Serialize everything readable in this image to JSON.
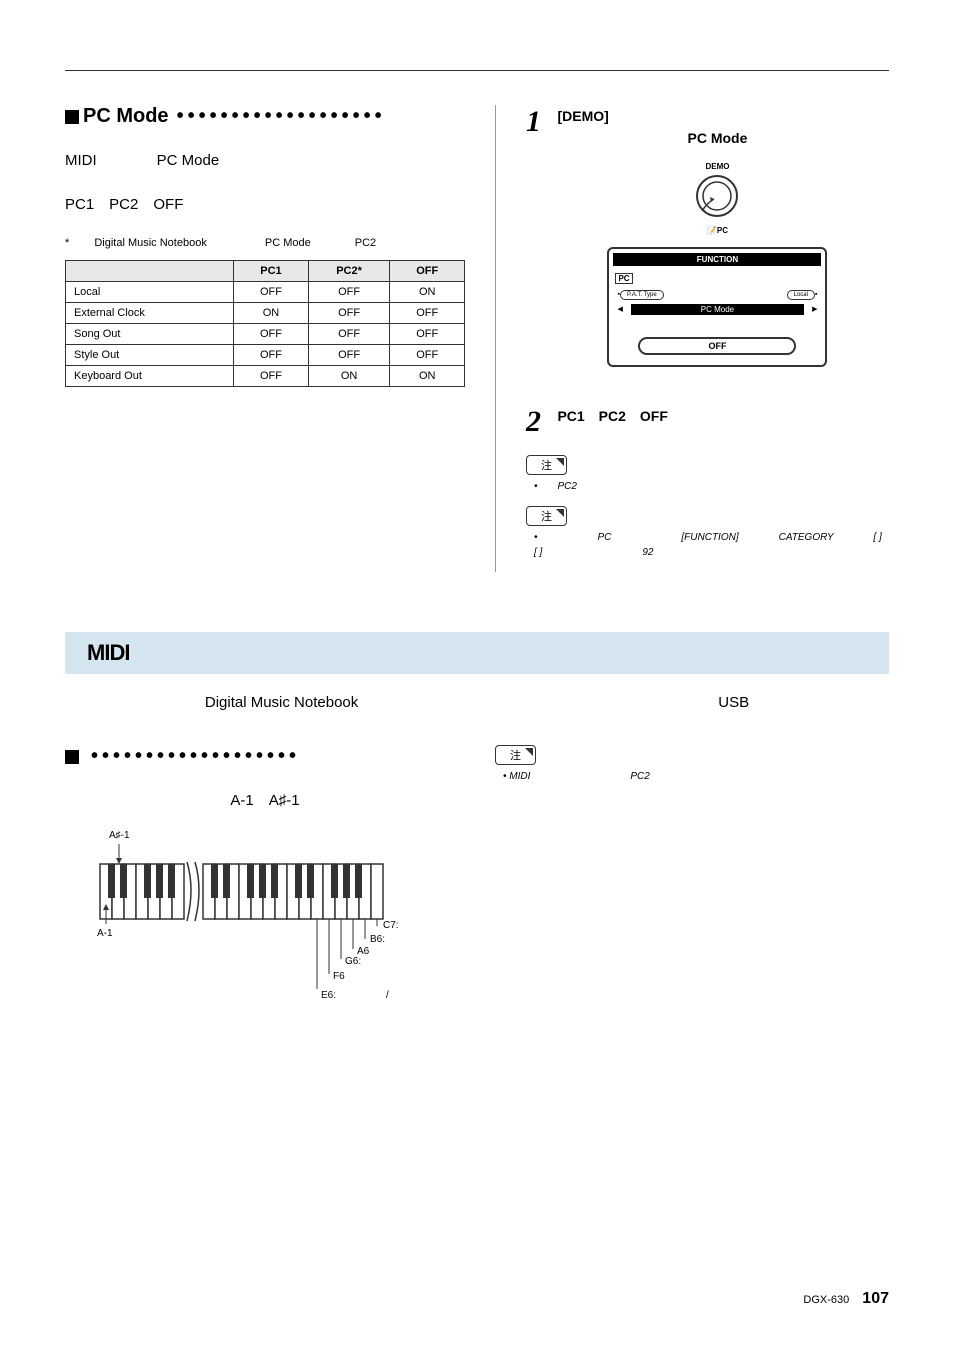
{
  "sections": {
    "pcmode": {
      "heading": "PC Mode",
      "body1": "MIDI　　　　PC Mode",
      "body2": "PC1　PC2　OFF",
      "note": "* 　　Digital Music Notebook 　　　　　PC Mode　　　　PC2"
    },
    "table": {
      "headers": [
        "",
        "PC1",
        "PC2*",
        "OFF"
      ],
      "rows": [
        [
          "Local",
          "OFF",
          "OFF",
          "ON"
        ],
        [
          "External Clock",
          "ON",
          "OFF",
          "OFF"
        ],
        [
          "Song Out",
          "OFF",
          "OFF",
          "OFF"
        ],
        [
          "Style Out",
          "OFF",
          "OFF",
          "OFF"
        ],
        [
          "Keyboard Out",
          "OFF",
          "ON",
          "ON"
        ]
      ]
    },
    "step1": {
      "num": "1",
      "demo": "[DEMO]",
      "title": "PC Mode",
      "demo_label": "DEMO",
      "pc_label": "PC",
      "lcd": {
        "function": "FUNCTION",
        "pc": "PC",
        "pat": "P.A.T. Type",
        "local": "Local",
        "mode": "PC Mode",
        "off": "OFF"
      }
    },
    "step2": {
      "num": "2",
      "title": "PC1　PC2　OFF",
      "note1_label": "注",
      "note1": "•　　PC2",
      "note2_label": "注",
      "note2": "•　　　　　　PC　　　　　　　[FUNCTION]　　　　CATEGORY　　　　[ ]　[ ]　　　　　　　　　　92"
    },
    "midi": {
      "heading": "MIDI",
      "body": "Digital Music Notebook　　　　　　　　　　　　　　　　　　　　　　　　USB",
      "subheading": "",
      "subtext": "A-1　A♯-1",
      "note_label": "注",
      "note": "• MIDI　　　　　　　　　　PC2",
      "key_labels": {
        "asharp": "A♯-1",
        "a1": "A-1",
        "c7": "C7:",
        "b6": "B6:",
        "a6": "A6",
        "g6": "G6:",
        "f6": "F6",
        "e6": "E6:　　　　　/"
      }
    }
  },
  "footer": {
    "model": "DGX-630",
    "page": "107"
  }
}
